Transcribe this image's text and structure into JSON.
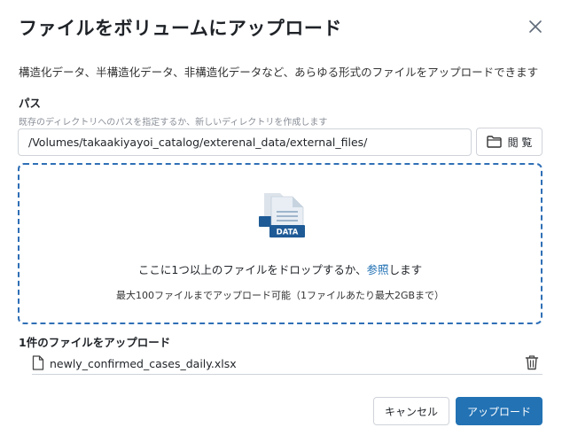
{
  "dialog": {
    "title": "ファイルをボリュームにアップロード",
    "description": "構造化データ、半構造化データ、非構造化データなど、あらゆる形式のファイルをアップロードできます"
  },
  "path": {
    "label": "パス",
    "hint": "既存のディレクトリへのパスを指定するか、新しいディレクトリを作成します",
    "value": "/Volumes/takaakiyayoi_catalog/exterenal_data/external_files/",
    "browse_label": "閲 覧"
  },
  "dropzone": {
    "icon_badge": "DATA",
    "main_before": "ここに1つ以上のファイルをドロップするか、",
    "main_link": "参照",
    "main_after": "します",
    "limit_text": "最大100ファイルまでアップロード可能（1ファイルあたり最大2GBまで）"
  },
  "upload_list": {
    "heading": "1件のファイルをアップロード",
    "files": [
      {
        "name": "newly_confirmed_cases_daily.xlsx"
      }
    ]
  },
  "footer": {
    "cancel_label": "キャンセル",
    "upload_label": "アップロード"
  },
  "colors": {
    "primary": "#2272b4",
    "dropzone_border": "#2f6fb6",
    "text": "#1f2328",
    "muted": "#8a8f98"
  },
  "icons": {
    "close": "close-icon",
    "browse": "folder-icon",
    "data": "data-file-icon",
    "file": "document-icon",
    "delete": "trash-icon"
  }
}
